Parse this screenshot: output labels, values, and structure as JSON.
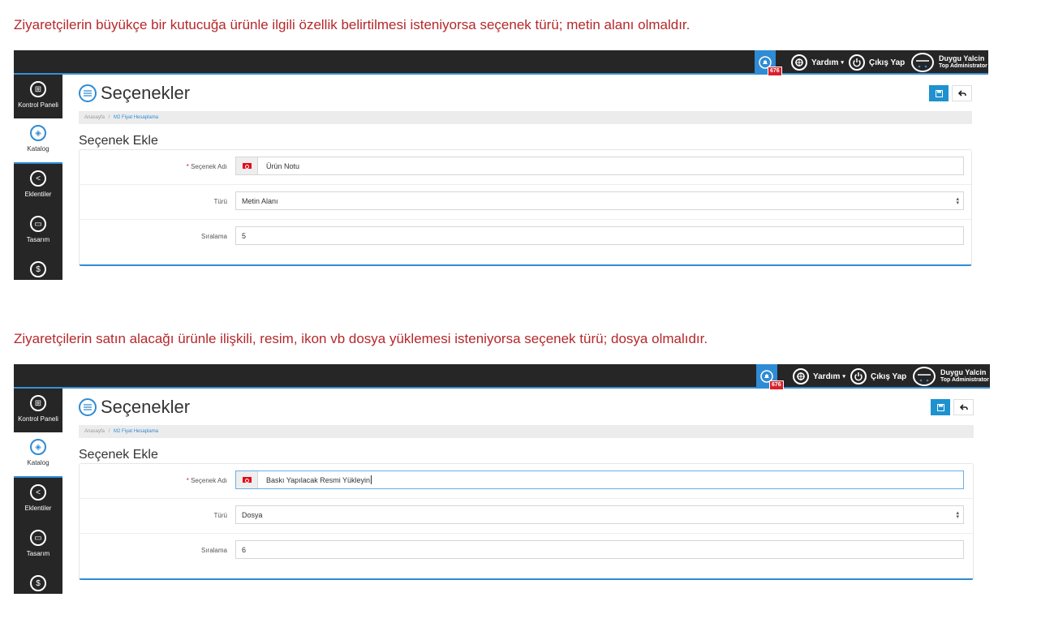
{
  "captions": [
    "Ziyaretçilerin büyükçe bir kutucuğa ürünle ilgili özellik belirtilmesi isteniyorsa seçenek türü; metin alanı olmaldır.",
    "Ziyaretçilerin satın alacağı ürünle ilişkili, resim, ikon vb dosya yüklemesi isteniyorsa seçenek türü; dosya olmalıdır."
  ],
  "colors": {
    "caption": "#b5282b",
    "accent": "#2f8bd4",
    "dark_bar": "#262626",
    "badge": "#d9202a"
  },
  "screens": [
    {
      "topbar": {
        "notification_count": "676",
        "help_label": "Yardım",
        "logout_label": "Çıkış Yap",
        "user_name": "Duygu Yalcin",
        "user_role": "Top Administrator"
      },
      "sidebar": [
        {
          "label": "Kontrol Paneli",
          "icon": "grid-icon",
          "active": false
        },
        {
          "label": "Katalog",
          "icon": "box-icon",
          "active": true
        },
        {
          "label": "Eklentiler",
          "icon": "share-icon",
          "active": false
        },
        {
          "label": "Tasarım",
          "icon": "monitor-icon",
          "active": false
        },
        {
          "label": "",
          "icon": "dollar-icon",
          "active": false
        }
      ],
      "page_title": "Seçenekler",
      "breadcrumb": {
        "home": "Anasayfa",
        "separator": "/",
        "current": "M2 Fiyat Hesaplama"
      },
      "section_title": "Seçenek Ekle",
      "form": {
        "name_label": "Seçenek Adı",
        "name_value": "Ürün Notu",
        "type_label": "Türü",
        "type_value": "Metin Alanı",
        "order_label": "Sıralama",
        "order_value": "5"
      }
    },
    {
      "topbar": {
        "notification_count": "676",
        "help_label": "Yardım",
        "logout_label": "Çıkış Yap",
        "user_name": "Duygu Yalcin",
        "user_role": "Top Administrator"
      },
      "sidebar": [
        {
          "label": "Kontrol Paneli",
          "icon": "grid-icon",
          "active": false
        },
        {
          "label": "Katalog",
          "icon": "box-icon",
          "active": true
        },
        {
          "label": "Eklentiler",
          "icon": "share-icon",
          "active": false
        },
        {
          "label": "Tasarım",
          "icon": "monitor-icon",
          "active": false
        },
        {
          "label": "",
          "icon": "dollar-icon",
          "active": false
        }
      ],
      "page_title": "Seçenekler",
      "breadcrumb": {
        "home": "Anasayfa",
        "separator": "/",
        "current": "M2 Fiyat Hesaplama"
      },
      "section_title": "Seçenek Ekle",
      "form": {
        "name_label": "Seçenek Adı",
        "name_value": "Baskı Yapılacak Resmi Yükleyin",
        "type_label": "Türü",
        "type_value": "Dosya",
        "order_label": "Sıralama",
        "order_value": "6"
      }
    }
  ]
}
